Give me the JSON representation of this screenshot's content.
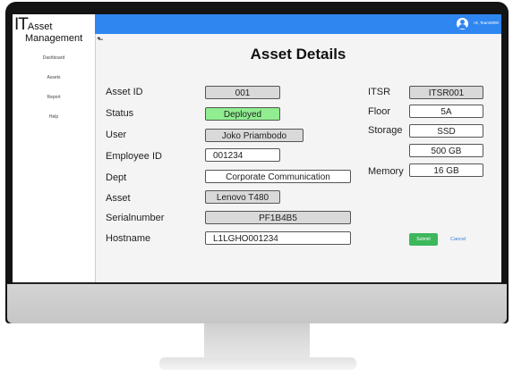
{
  "app": {
    "logo_prefix": "IT",
    "logo_word1": "Asset",
    "logo_word2": "Management"
  },
  "sidebar": {
    "items": [
      {
        "label": "Dashboard"
      },
      {
        "label": "Assets"
      },
      {
        "label": "Report"
      },
      {
        "label": "Help"
      }
    ]
  },
  "topbar": {
    "user_greeting": "Hi, Team0000",
    "icon": "user-avatar-icon",
    "color": "#2f86f0"
  },
  "page": {
    "back_icon": "back-arrow-icon",
    "title": "Asset Details"
  },
  "form_left": [
    {
      "label": "Asset ID",
      "value": "001"
    },
    {
      "label": "Status",
      "value": "Deployed"
    },
    {
      "label": "User",
      "value": "Joko Priambodo"
    },
    {
      "label": "Employee ID",
      "value": "001234"
    },
    {
      "label": "Dept",
      "value": "Corporate Communication"
    },
    {
      "label": "Asset",
      "value": "Lenovo T480"
    },
    {
      "label": "Serialnumber",
      "value": "PF1B4B5"
    },
    {
      "label": "Hostname",
      "value": "L1LGHO001234"
    }
  ],
  "form_right": {
    "itsr": {
      "label": "ITSR",
      "value": "ITSR001"
    },
    "floor": {
      "label": "Floor",
      "value": "5A"
    },
    "storage": {
      "label": "Storage",
      "type_value": "SSD",
      "size_value": "500 GB"
    },
    "memory": {
      "label": "Memory",
      "value": "16 GB"
    }
  },
  "actions": {
    "submit": "Submit",
    "cancel": "Cancel",
    "submit_color": "#3cb85c",
    "status_color": "#90ee90"
  }
}
